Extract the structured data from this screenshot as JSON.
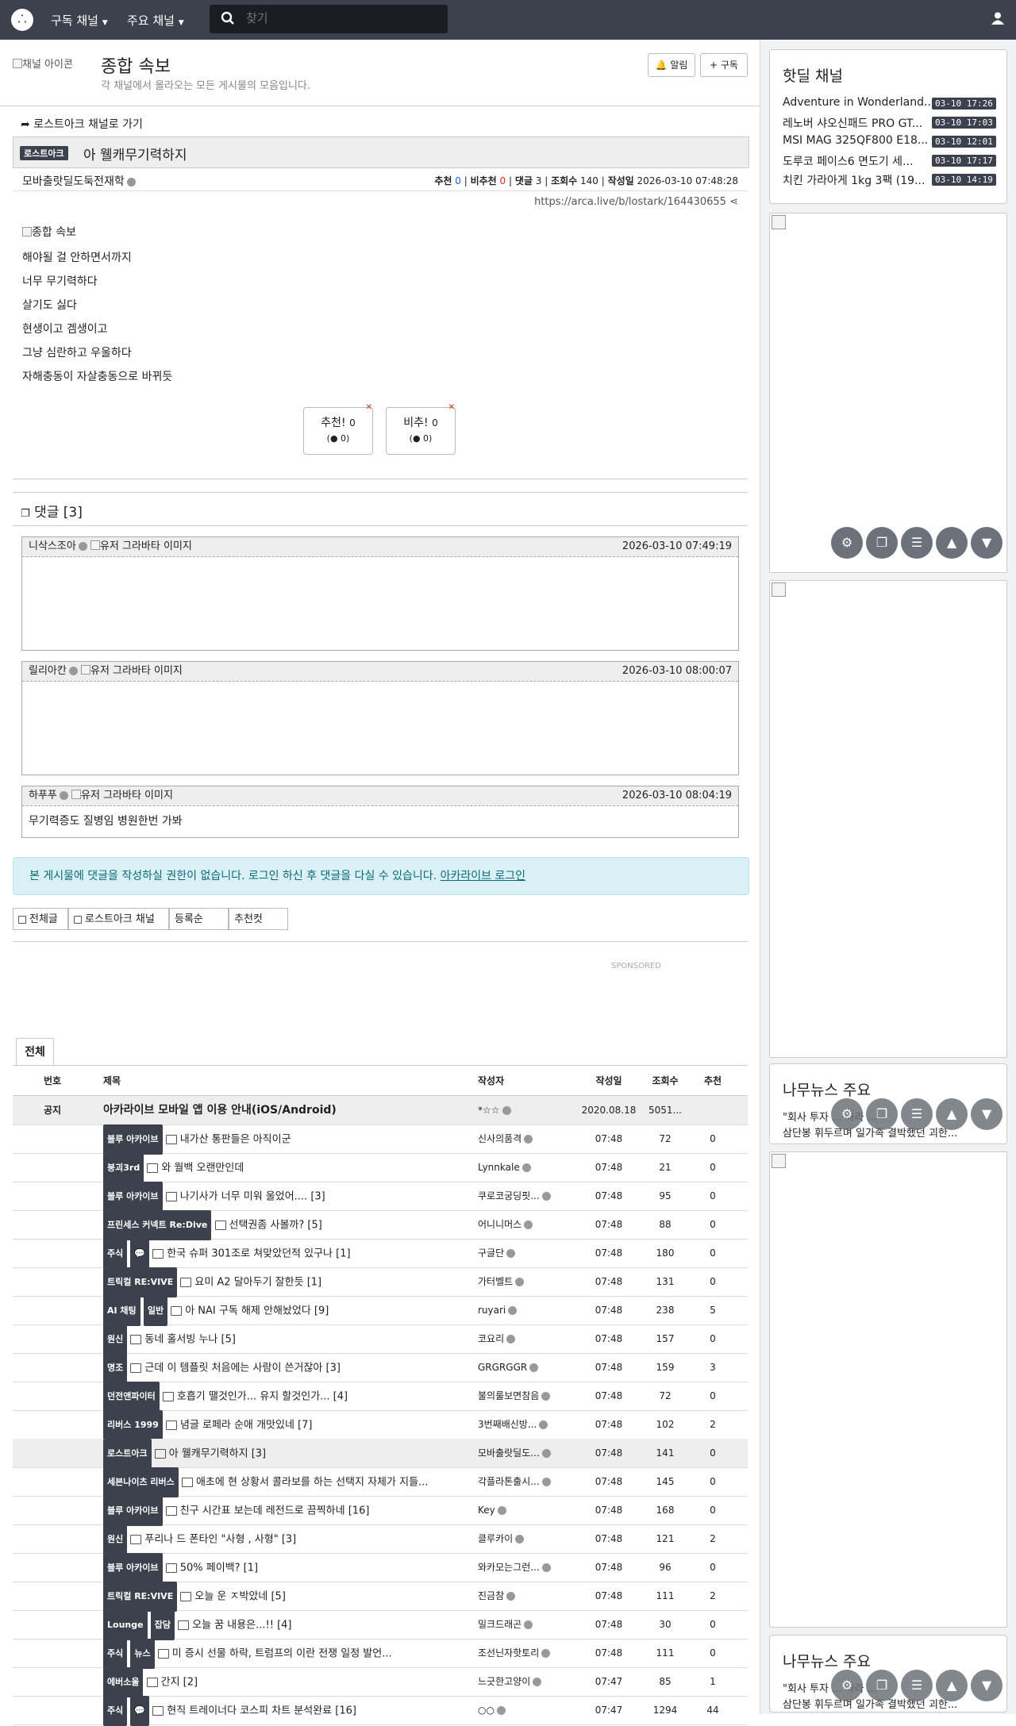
{
  "topbar": {
    "logo": "⸫",
    "nav_subscribed": "구독 채널",
    "nav_main": "주요 채널",
    "search_placeholder": "찾기"
  },
  "channel": {
    "icon_alt": "채널 아이콘",
    "title": "종합 속보",
    "description": "각 채널에서 올라오는 모든 게시물의 모음입니다.",
    "alarm_label": "알림",
    "subscribe_label": "구독"
  },
  "post": {
    "back_link": "로스트아크 채널로 가기",
    "category": "로스트아크",
    "title": "아 웰캐무기력하지",
    "author": "모바출랏딜도둑전재학",
    "stats": {
      "rec_label": "추천",
      "rec": "0",
      "unrec_label": "비추천",
      "unrec": "0",
      "comments_label": "댓글",
      "comments": "3",
      "views_label": "조회수",
      "views": "140",
      "date_label": "작성일",
      "date": "2026-03-10 07:48:28"
    },
    "url": "https://arca.live/b/lostark/164430655",
    "image_alt": "종합 속보",
    "body_lines": [
      "해야될 걸 안하면서까지",
      "너무 무기력하다",
      "살기도 싫다",
      "현생이고 겜생이고",
      "그냥 심란하고 우울하다",
      "자해충동이 자살충동으로 바뀌듯"
    ],
    "vote_up_label": "추천!",
    "vote_up": "0",
    "vote_up_sub": "0",
    "vote_down_label": "비추!",
    "vote_down": "0",
    "vote_down_sub": "0"
  },
  "comments": {
    "header": "댓글 [3]",
    "avatar_alt": "유저 그라바타 이미지",
    "items": [
      {
        "author": "니삭스조아",
        "time": "2026-03-10 07:49:19",
        "text": ""
      },
      {
        "author": "릴리아칸",
        "time": "2026-03-10 08:00:07",
        "text": ""
      },
      {
        "author": "하푸푸",
        "time": "2026-03-10 08:04:19",
        "text": "무기력증도 질병임 병원한번 가봐"
      }
    ],
    "notice_text": "본 게시물에 댓글을 작성하실 권한이 없습니다. 로그인 하신 후 댓글을 다실 수 있습니다.",
    "notice_link": "아카라이브 로그인"
  },
  "filter_tabs": [
    "전체글",
    "로스트아크 채널",
    "등록순",
    "추천컷"
  ],
  "sponsored": "SPONSORED",
  "list": {
    "tab": "전체",
    "headers": {
      "num": "번호",
      "title": "제목",
      "author": "작성자",
      "date": "작성일",
      "views": "조회수",
      "rec": "추천"
    },
    "notice": {
      "num": "공지",
      "title": "아카라이브 모바일 앱 이용 안내(iOS/Android)",
      "author": "*☆☆",
      "date": "2020.08.18",
      "views": "5051...",
      "rec": ""
    },
    "rows": [
      {
        "badges": [
          "블루 아카이브"
        ],
        "title": "내가산 통판들은 아직이군",
        "author": "신사의품격",
        "date": "07:48",
        "views": "72",
        "rec": "0"
      },
      {
        "badges": [
          "붕괴3rd"
        ],
        "title": "와 월백 오랜만인데",
        "author": "Lynnkale",
        "date": "07:48",
        "views": "21",
        "rec": "0"
      },
      {
        "badges": [
          "블루 아카이브"
        ],
        "title": "나기사가 너무 미워 울었어.... [3]",
        "author": "쿠로코궁딩핏...",
        "date": "07:48",
        "views": "95",
        "rec": "0"
      },
      {
        "badges": [
          "프린세스 커넥트 Re:Dive"
        ],
        "title": "선택권좀 사볼까? [5]",
        "author": "어니니머스",
        "date": "07:48",
        "views": "88",
        "rec": "0"
      },
      {
        "badges": [
          "주식",
          "💬"
        ],
        "title": "한국 슈퍼 301조로 쳐맞았던적 있구나 [1]",
        "author": "구글단",
        "date": "07:48",
        "views": "180",
        "rec": "0"
      },
      {
        "badges": [
          "트릭컬 RE:VIVE"
        ],
        "title": "요미 A2 달아두기 잘한듯 [1]",
        "author": "가터벨트",
        "date": "07:48",
        "views": "131",
        "rec": "0"
      },
      {
        "badges": [
          "AI 채팅",
          "일반"
        ],
        "title": "아 NAI 구독 해제 안해놨었다 [9]",
        "author": "ruyari",
        "date": "07:48",
        "views": "238",
        "rec": "5"
      },
      {
        "badges": [
          "원신"
        ],
        "title": "동네 홀서빙 누나 [5]",
        "author": "코요리",
        "date": "07:48",
        "views": "157",
        "rec": "0"
      },
      {
        "badges": [
          "명조"
        ],
        "title": "근데 이 템플릿 처음에는 사람이 쓴거잖아 [3]",
        "author": "GRGRGGR",
        "date": "07:48",
        "views": "159",
        "rec": "3"
      },
      {
        "badges": [
          "던전앤파이터"
        ],
        "title": "호흡기 땔것인가... 유지 할것인가... [4]",
        "author": "불의룰보면참음",
        "date": "07:48",
        "views": "72",
        "rec": "0"
      },
      {
        "badges": [
          "리버스 1999"
        ],
        "title": "념글 로페라 순애 개맛있네 [7]",
        "author": "3번째배신방...",
        "date": "07:48",
        "views": "102",
        "rec": "2"
      },
      {
        "badges": [
          "로스트아크"
        ],
        "title": "아 웰캐무기력하지 [3]",
        "author": "모바출랏딜도...",
        "date": "07:48",
        "views": "141",
        "rec": "0",
        "hl": true
      },
      {
        "badges": [
          "세븐나이츠 리버스"
        ],
        "title": "애초에 현 상황서 콜라보를 하는 선택지 자체가 지들...",
        "author": "각플라톤출시...",
        "date": "07:48",
        "views": "145",
        "rec": "0"
      },
      {
        "badges": [
          "블루 아카이브"
        ],
        "title": "친구 시간표 보는데 레전드로 끔찍하네 [16]",
        "author": "Key",
        "date": "07:48",
        "views": "168",
        "rec": "0"
      },
      {
        "badges": [
          "원신"
        ],
        "title": "푸리나 드 폰타인 \"사형 , 사형\" [3]",
        "author": "클루카이",
        "date": "07:48",
        "views": "121",
        "rec": "2"
      },
      {
        "badges": [
          "블루 아카이브"
        ],
        "title": "50% 페이백? [1]",
        "author": "와카모는그런...",
        "date": "07:48",
        "views": "96",
        "rec": "0"
      },
      {
        "badges": [
          "트릭컬 RE:VIVE"
        ],
        "title": "오늘 운 ㅈ박았네 [5]",
        "author": "진금참",
        "date": "07:48",
        "views": "111",
        "rec": "2"
      },
      {
        "badges": [
          "Lounge",
          "잡담"
        ],
        "title": "오늘 꿈 내용은...!! [4]",
        "author": "밀크드래곤",
        "date": "07:48",
        "views": "30",
        "rec": "0"
      },
      {
        "badges": [
          "주식",
          "뉴스"
        ],
        "title": "미 증시 선물 하락, 트럼프의 이란 전쟁 일정 발언...",
        "author": "조선닌자핫토리",
        "date": "07:48",
        "views": "111",
        "rec": "0"
      },
      {
        "badges": [
          "에버소울"
        ],
        "title": "간지 [2]",
        "author": "느긋한고양이",
        "date": "07:47",
        "views": "85",
        "rec": "1"
      },
      {
        "badges": [
          "주식",
          "💬"
        ],
        "title": "현직 트레이너다 코스피 차트 분석완료 [16]",
        "author": "○○",
        "date": "07:47",
        "views": "1294",
        "rec": "44"
      }
    ]
  },
  "sidebar": {
    "hot_title": "핫딜 채널",
    "hot_items": [
      {
        "title": "Adventure in Wonderland...",
        "date": "03-10 17:26"
      },
      {
        "title": "레노버 샤오신패드 PRO GT...",
        "date": "03-10 17:03"
      },
      {
        "title": "MSI MAG 325QF800 E18...",
        "date": "03-10 12:01"
      },
      {
        "title": "도루코 페이스6 면도기 세...",
        "date": "03-10 17:17"
      },
      {
        "title": "치킨 가라아게 1kg 3팩 (19...",
        "date": "03-10 14:19"
      }
    ],
    "news_title": "나무뉴스 주요",
    "news_line1": "\"회사 투자 ... 나라 ...",
    "news_line2": "삼단봉 휘두르며 일가족 결박했던 괴한..."
  }
}
